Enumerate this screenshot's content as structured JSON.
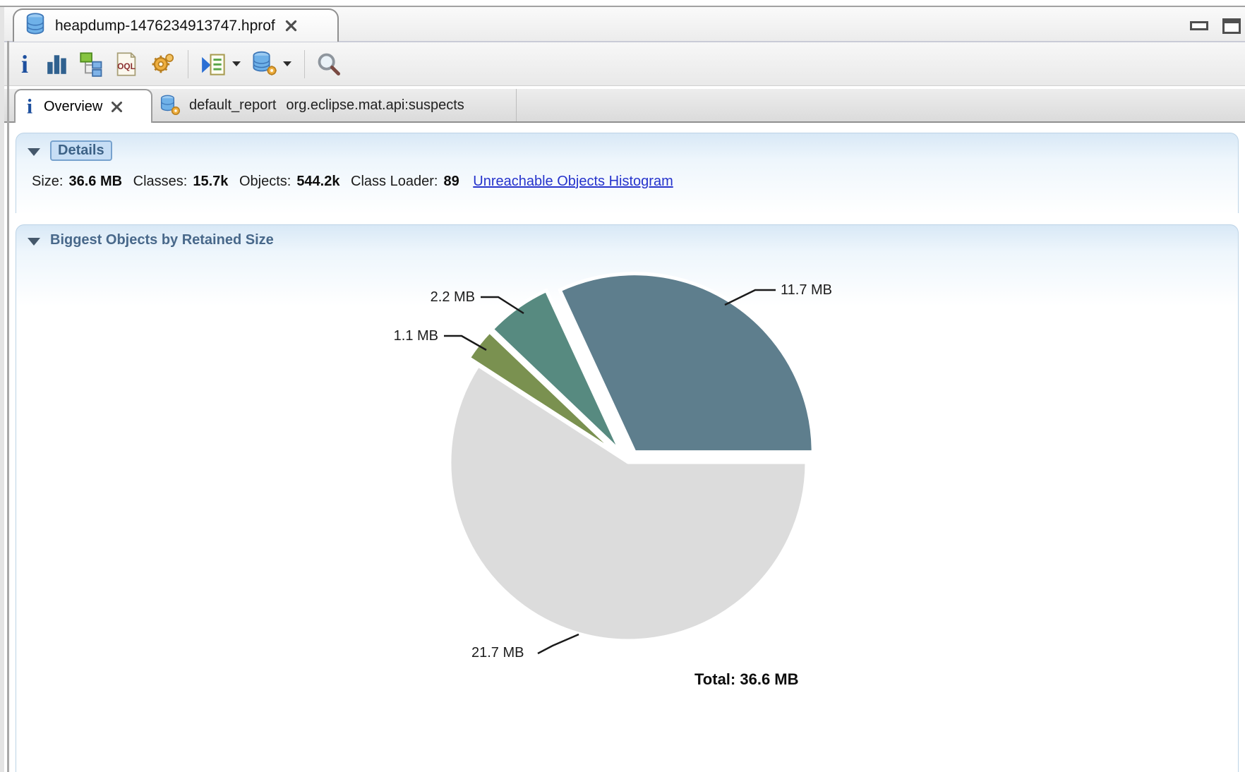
{
  "window": {
    "editor_tab_title": "heapdump-1476234913747.hprof"
  },
  "toolbar": {
    "info_glyph": "i",
    "oql_icon_text": "OQL",
    "icons": [
      "info",
      "histogram",
      "dominator-tree",
      "oql",
      "expert-system",
      "run-report",
      "query-browser",
      "search"
    ]
  },
  "view_tabs": [
    {
      "label": "Overview"
    },
    {
      "label": "default_report",
      "sublabel": "org.eclipse.mat.api:suspects"
    }
  ],
  "details": {
    "header": "Details",
    "size_label": "Size:",
    "size_value": "36.6 MB",
    "classes_label": "Classes:",
    "classes_value": "15.7k",
    "objects_label": "Objects:",
    "objects_value": "544.2k",
    "classloader_label": "Class Loader:",
    "classloader_value": "89",
    "link_label": "Unreachable Objects Histogram"
  },
  "biggest_objects": {
    "header": "Biggest Objects by Retained Size"
  },
  "chart_data": {
    "type": "pie",
    "title": "Biggest Objects by Retained Size",
    "unit": "MB",
    "total_mb": 36.6,
    "start_angle_deg": 0,
    "direction": "ccw",
    "legend_position": "none",
    "slices": [
      {
        "label": "11.7 MB",
        "value": 11.7,
        "color": "#5E7E8D",
        "exploded": true
      },
      {
        "label": "2.2 MB",
        "value": 2.2,
        "color": "#578A80",
        "exploded": true
      },
      {
        "label": "1.1 MB",
        "value": 1.1,
        "color": "#7A9150",
        "exploded": true
      },
      {
        "label": "21.7 MB",
        "value": 21.7,
        "color": "#DCDCDC",
        "exploded": false
      }
    ],
    "annotation_total": "Total: 36.6 MB"
  }
}
